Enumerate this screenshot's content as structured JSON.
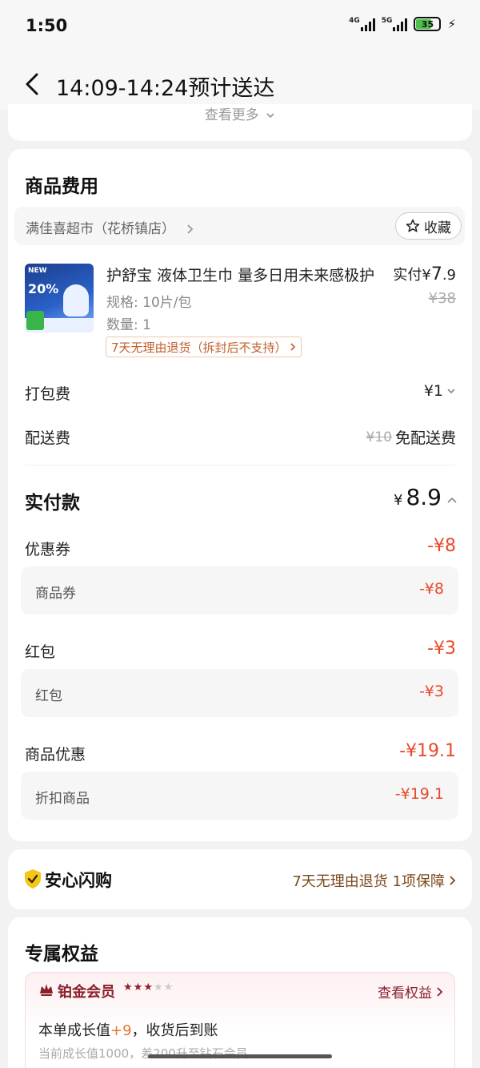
{
  "status_bar": {
    "time": "1:50",
    "net1": "4G",
    "net2": "5G",
    "battery": "35"
  },
  "nav": {
    "title": "14:09-14:24预计送达"
  },
  "top_card": {
    "see_more": "查看更多"
  },
  "fee_section": {
    "title": "商品费用",
    "store_name": "满佳喜超市（花桥镇店）",
    "fav_label": "收藏",
    "product": {
      "name": "护舒宝 液体卫生巾 量多日用未来感极护",
      "paid_label": "实付",
      "paid_yen": "¥",
      "paid_int": "7",
      "paid_dec": ".9",
      "orig_price": "¥38",
      "spec": "规格: 10片/包",
      "qty": "数量: 1",
      "return_tag": "7天无理由退货（拆封后不支持）",
      "img_tag": "NEW",
      "img_pct": "20%"
    },
    "packing": {
      "label": "打包费",
      "value": "¥1"
    },
    "delivery": {
      "label": "配送费",
      "orig": "¥10",
      "value": "免配送费"
    },
    "pay": {
      "label": "实付款",
      "yen": "¥",
      "value": "8.9"
    },
    "coupon": {
      "label": "优惠券",
      "value": "-¥8",
      "sub_label": "商品券",
      "sub_value": "-¥8"
    },
    "redpacket": {
      "label": "红包",
      "value": "-¥3",
      "sub_label": "红包",
      "sub_value": "-¥3"
    },
    "product_discount": {
      "label": "商品优惠",
      "value": "-¥19.1",
      "sub_label": "折扣商品",
      "sub_value": "-¥19.1"
    }
  },
  "safe_section": {
    "title": "安心闪购",
    "right_text": "7天无理由退货 1项保障"
  },
  "benefit_section": {
    "title": "专属权益",
    "vip_name": "铂金会员",
    "stars_on": 3,
    "stars_total": 5,
    "vip_link": "查看权益",
    "growth_prefix": "本单成长值",
    "growth_value": "+9",
    "growth_suffix": "，收货后到账",
    "sub_text": "当前成长值1000，差200升至钻石会员"
  },
  "colors": {
    "accent_red": "#e8492b",
    "vip": "#8a1f2a",
    "safe_gold": "#f5c518"
  }
}
